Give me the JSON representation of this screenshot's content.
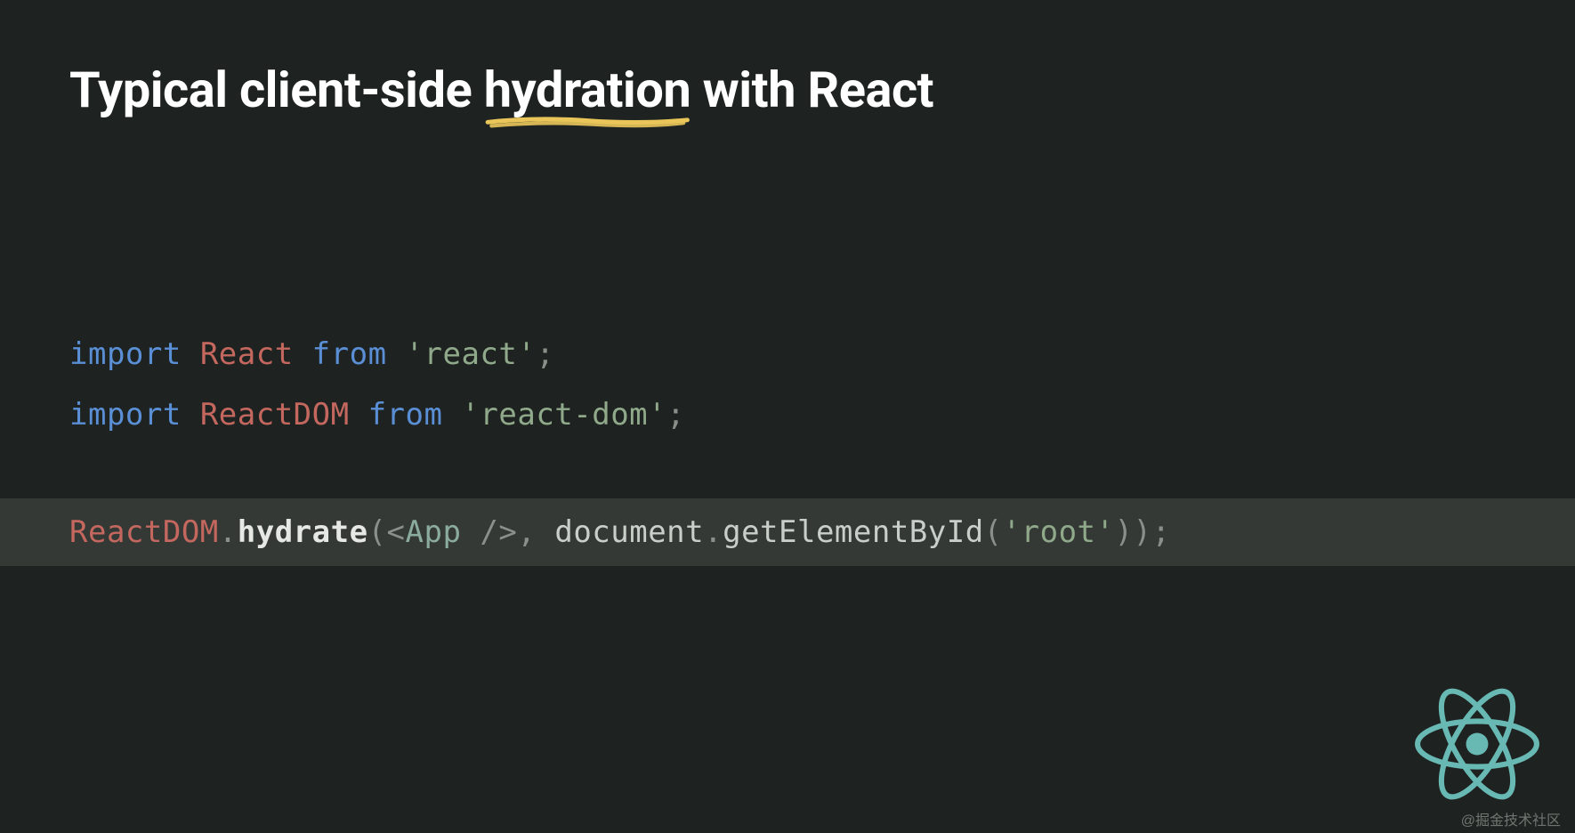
{
  "title": {
    "prefix": "Typical client-side ",
    "highlight": "hydration",
    "suffix": " with React"
  },
  "code": {
    "line1": {
      "t1": "import",
      "t2": " ",
      "t3": "React",
      "t4": " ",
      "t5": "from",
      "t6": " ",
      "t7": "'react'",
      "t8": ";"
    },
    "line2": {
      "t1": "import",
      "t2": " ",
      "t3": "ReactDOM",
      "t4": " ",
      "t5": "from",
      "t6": " ",
      "t7": "'react-dom'",
      "t8": ";"
    },
    "line3": {
      "t1": "ReactDOM",
      "t2": ".",
      "t3": "hydrate",
      "t4": "(",
      "t5": "<",
      "t6": "App",
      "t7": " ",
      "t8": "/>",
      "t9": ",",
      "t10": " ",
      "t11": "document",
      "t12": ".",
      "t13": "getElementById",
      "t14": "(",
      "t15": "'root'",
      "t16": "))",
      "t17": ";"
    }
  },
  "watermark": "@掘金技术社区",
  "logo": {
    "name": "react-logo-icon",
    "color": "#68b8b3"
  }
}
